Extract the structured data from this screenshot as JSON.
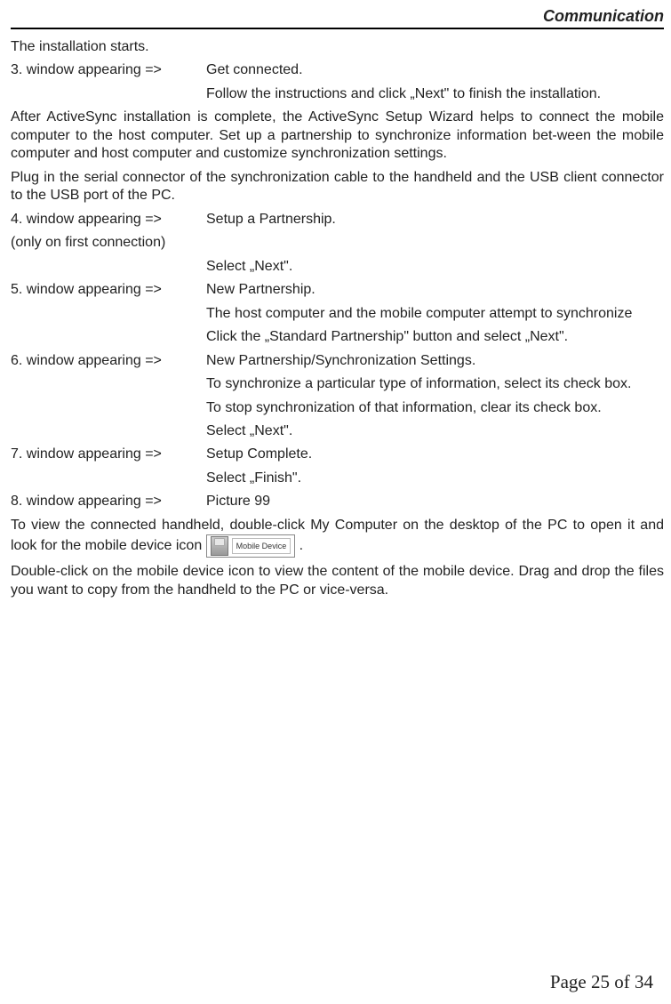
{
  "header": {
    "title": "Communication"
  },
  "intro": {
    "text": "The installation starts."
  },
  "step3": {
    "label": "3. window appearing =>",
    "line1": "Get connected.",
    "line2": "Follow the instructions and click „Next\" to finish the installation."
  },
  "after_install": {
    "p1": "After ActiveSync installation is complete, the ActiveSync Setup Wizard helps to connect the mobile computer to the host computer. Set up a partnership to synchronize information bet-ween the mobile computer and host computer and customize synchronization settings.",
    "p2": "Plug in the serial connector of the synchronization cable to the handheld and the USB client connector to the USB port of the PC."
  },
  "step4": {
    "label": "4. window appearing =>",
    "line1": "Setup a Partnership.",
    "sub": "(only on first connection)",
    "line2": "Select „Next\"."
  },
  "step5": {
    "label": "5. window appearing =>",
    "line1": "New Partnership.",
    "line2": "The host computer and the mobile computer attempt to synchronize",
    "line3": "Click the „Standard Partnership\" button and select „Next\"."
  },
  "step6": {
    "label": "6. window appearing =>",
    "line1": "New Partnership/Synchronization Settings.",
    "line2": "To synchronize a particular type of information, select its check box.",
    "line3": "To stop synchronization of that information, clear its check box.",
    "line4": "Select „Next\"."
  },
  "step7": {
    "label": "7. window appearing =>",
    "line1": "Setup Complete.",
    "line2": "Select „Finish\"."
  },
  "step8": {
    "label": "8. window appearing =>",
    "line1": "Picture 99"
  },
  "view": {
    "pre": "To view the connected handheld, double-click My Computer on the desktop of the PC to open it and look for the mobile device icon ",
    "icon_label": "Mobile Device",
    "post": "."
  },
  "double_click": {
    "text": "Double-click on the mobile device icon to view the content of the mobile device. Drag and drop the files you want to copy from the handheld to the PC or vice-versa."
  },
  "footer": {
    "text": "Page 25 of 34"
  }
}
